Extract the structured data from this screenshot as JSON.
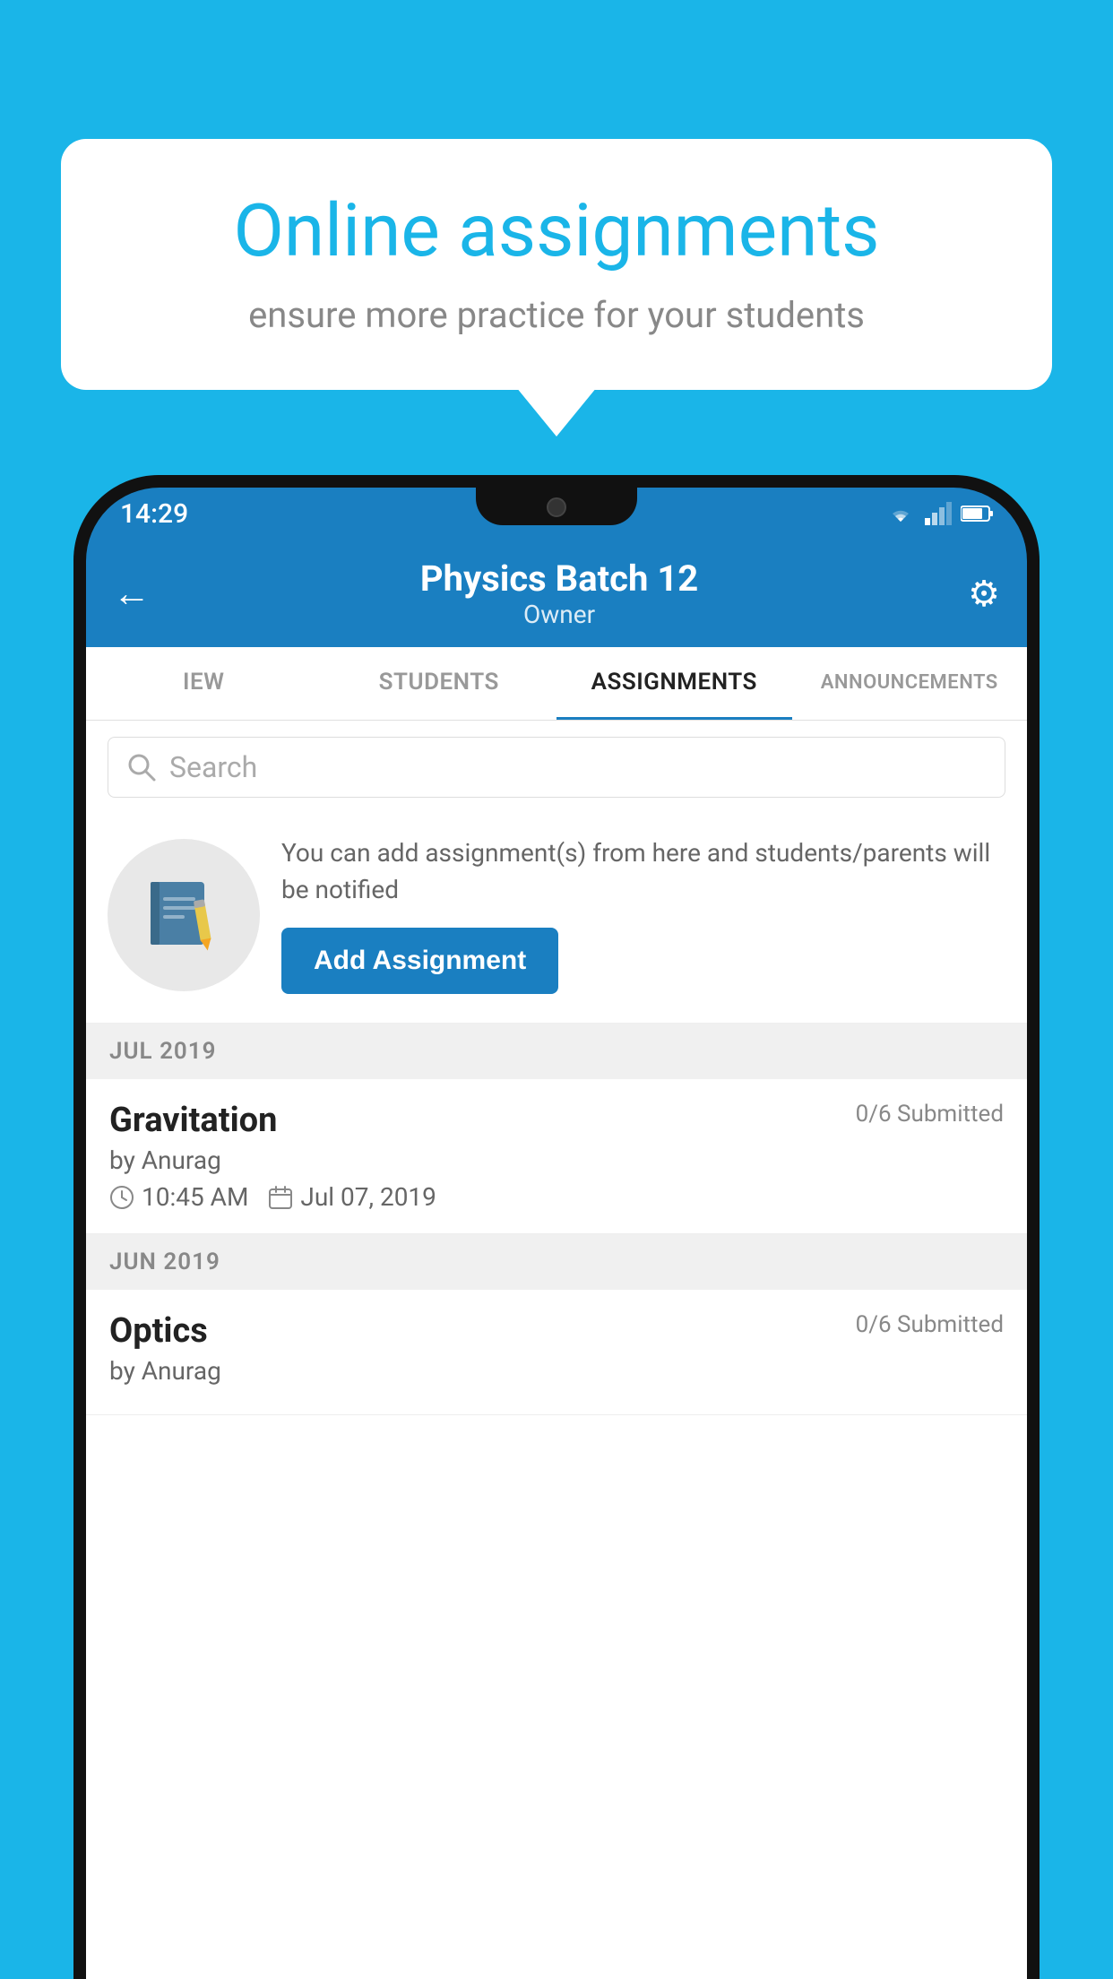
{
  "background": {
    "color": "#1ab5e8"
  },
  "speech_bubble": {
    "title": "Online assignments",
    "subtitle": "ensure more practice for your students"
  },
  "status_bar": {
    "time": "14:29",
    "icons": [
      "wifi",
      "signal",
      "battery"
    ]
  },
  "header": {
    "title": "Physics Batch 12",
    "subtitle": "Owner",
    "back_label": "←",
    "settings_label": "⚙"
  },
  "tabs": [
    {
      "label": "IEW",
      "active": false
    },
    {
      "label": "STUDENTS",
      "active": false
    },
    {
      "label": "ASSIGNMENTS",
      "active": true
    },
    {
      "label": "ANNOUNCEMENTS",
      "active": false
    }
  ],
  "search": {
    "placeholder": "Search"
  },
  "promo": {
    "description": "You can add assignment(s) from here and students/parents will be notified",
    "button_label": "Add Assignment"
  },
  "sections": [
    {
      "header": "JUL 2019",
      "assignments": [
        {
          "name": "Gravitation",
          "submitted": "0/6 Submitted",
          "by": "by Anurag",
          "time": "10:45 AM",
          "date": "Jul 07, 2019"
        }
      ]
    },
    {
      "header": "JUN 2019",
      "assignments": [
        {
          "name": "Optics",
          "submitted": "0/6 Submitted",
          "by": "by Anurag",
          "time": "",
          "date": ""
        }
      ]
    }
  ]
}
